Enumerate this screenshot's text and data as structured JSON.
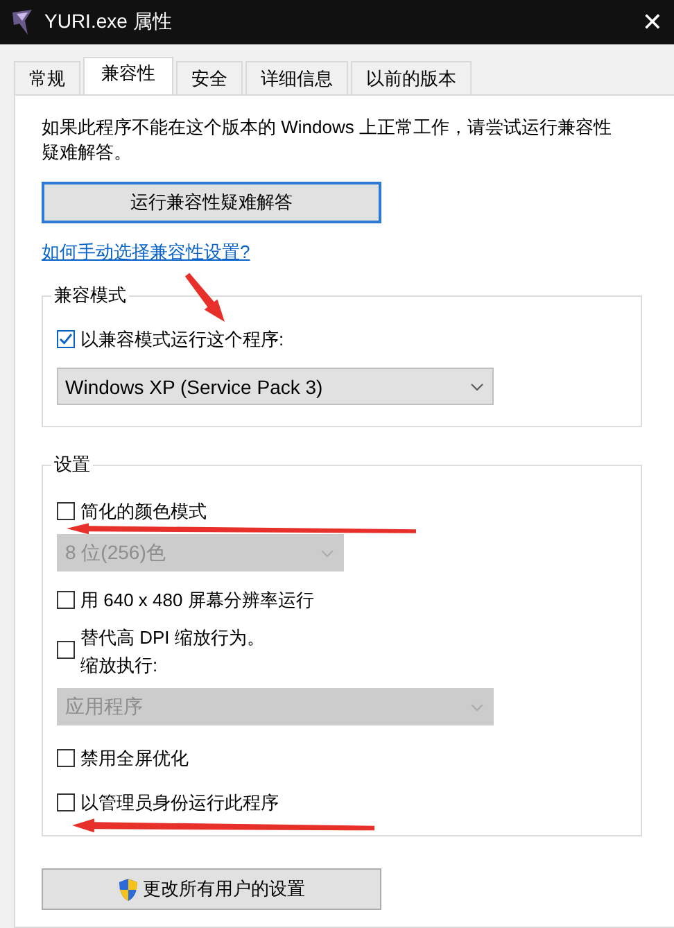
{
  "window": {
    "title": "YURI.exe 属性",
    "close": "✕"
  },
  "tabs": [
    {
      "label": "常规",
      "selected": false
    },
    {
      "label": "兼容性",
      "selected": true
    },
    {
      "label": "安全",
      "selected": false
    },
    {
      "label": "详细信息",
      "selected": false
    },
    {
      "label": "以前的版本",
      "selected": false
    }
  ],
  "intro": "如果此程序不能在这个版本的 Windows 上正常工作，请尝试运行兼容性疑难解答。",
  "troubleshoot_button": "运行兼容性疑难解答",
  "help_link": "如何手动选择兼容性设置?",
  "compat_mode": {
    "legend": "兼容模式",
    "items": [
      {
        "kind": "checkbox",
        "label": "以兼容模式运行这个程序:",
        "checked": true
      },
      {
        "kind": "dropdown",
        "value": "Windows XP (Service Pack 3)",
        "disabled": false
      }
    ]
  },
  "settings": {
    "legend": "设置",
    "items": [
      {
        "kind": "checkbox",
        "label": "简化的颜色模式",
        "checked": false
      },
      {
        "kind": "dropdown",
        "value": "8 位(256)色",
        "disabled": true
      },
      {
        "kind": "checkbox",
        "label": "用 640 x 480 屏幕分辨率运行",
        "checked": false
      },
      {
        "kind": "checkbox",
        "label": "替代高 DPI 缩放行为。",
        "sublabel": "缩放执行:",
        "checked": false
      },
      {
        "kind": "dropdown",
        "value": "应用程序",
        "disabled": true
      },
      {
        "kind": "checkbox",
        "label": "禁用全屏优化",
        "checked": false
      },
      {
        "kind": "checkbox",
        "label": "以管理员身份运行此程序",
        "checked": false
      }
    ]
  },
  "all_users_button": "更改所有用户的设置"
}
